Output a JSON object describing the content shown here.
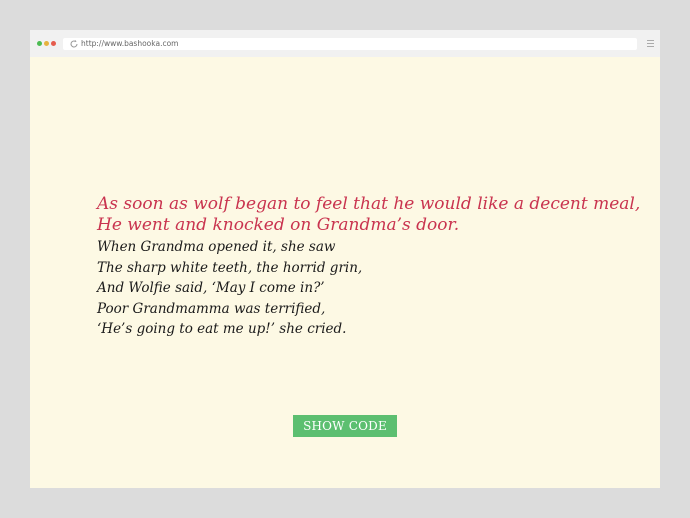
{
  "browser": {
    "url": "http://www.bashooka.com",
    "icons": {
      "refresh": "refresh-icon",
      "menu": "hamburger-menu-icon"
    },
    "window_controls": [
      "green",
      "yellow",
      "red"
    ]
  },
  "poem": {
    "highlight_lines": [
      "As soon as wolf began to feel that he would like a decent meal,",
      "He went and knocked on Grandma’s door."
    ],
    "lines": [
      "When Grandma opened it, she saw",
      "The sharp white teeth, the horrid grin,",
      "And Wolfie said, ‘May I come in?’",
      "Poor Grandmamma was terrified,",
      "‘He’s going to eat me up!’ she cried."
    ]
  },
  "button": {
    "label": "SHOW CODE"
  },
  "colors": {
    "page_background": "#fdf9e4",
    "highlight_text": "#c9344f",
    "body_text": "#1a1a1a",
    "button_background": "#5cbf70",
    "button_text": "#ffffff"
  }
}
